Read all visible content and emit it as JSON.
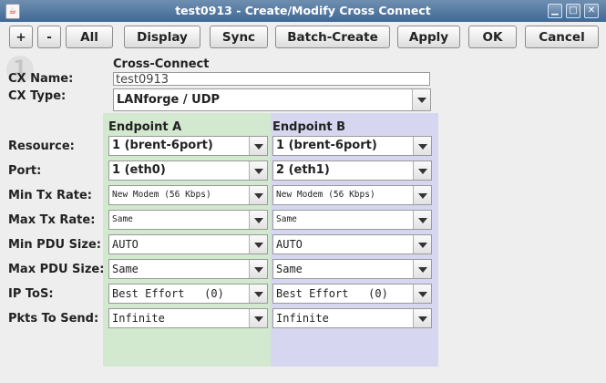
{
  "window": {
    "title": "test0913 - Create/Modify Cross Connect"
  },
  "toolbar": {
    "plus_label": "+",
    "minus_label": "-",
    "all_label": "All",
    "display_label": "Display",
    "sync_label": "Sync",
    "batch_create_label": "Batch-Create",
    "apply_label": "Apply",
    "ok_label": "OK",
    "cancel_label": "Cancel"
  },
  "form": {
    "step_number": "1",
    "section_title": "Cross-Connect",
    "cx_name_label": "CX Name:",
    "cx_name_value": "test0913",
    "cx_type_label": "CX Type:",
    "cx_type_value": "LANforge / UDP",
    "endpoint_a_title": "Endpoint A",
    "endpoint_b_title": "Endpoint B",
    "rows": [
      {
        "label": "Resource:",
        "a": "1 (brent-6port)",
        "b": "1 (brent-6port)"
      },
      {
        "label": "Port:",
        "a": "1 (eth0)",
        "b": "2 (eth1)"
      },
      {
        "label": "Min Tx Rate:",
        "a": "New Modem (56 Kbps)",
        "b": "New Modem (56 Kbps)"
      },
      {
        "label": "Max Tx Rate:",
        "a": "Same",
        "b": "Same"
      },
      {
        "label": "Min PDU Size:",
        "a": "AUTO",
        "b": "AUTO"
      },
      {
        "label": "Max PDU Size:",
        "a": "Same",
        "b": "Same"
      },
      {
        "label": "IP ToS:",
        "a": "Best Effort   (0)",
        "b": "Best Effort   (0)"
      },
      {
        "label": "Pkts To Send:",
        "a": "Infinite",
        "b": "Infinite"
      }
    ]
  },
  "colors": {
    "endpoint_a_bg": "#d2e9cf",
    "endpoint_b_bg": "#d6d6f0",
    "titlebar": "#4f749c"
  }
}
